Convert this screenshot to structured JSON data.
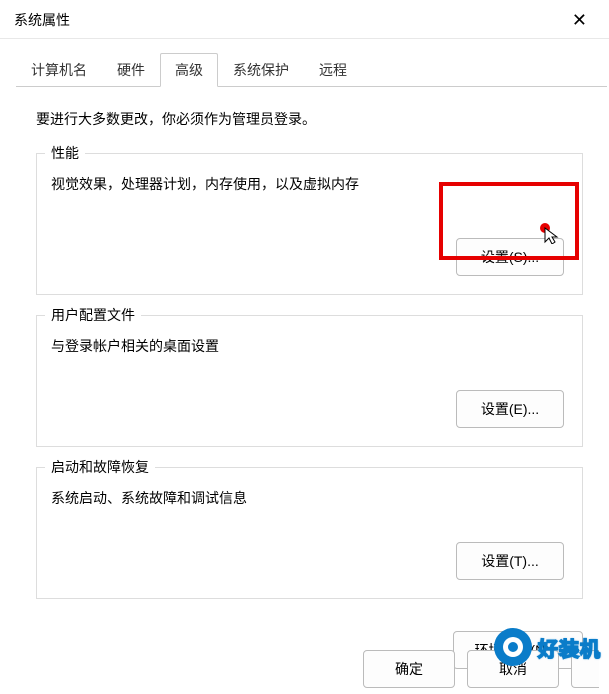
{
  "window": {
    "title": "系统属性",
    "close_icon": "✕"
  },
  "tabs": {
    "computer_name": "计算机名",
    "hardware": "硬件",
    "advanced": "高级",
    "system_protection": "系统保护",
    "remote": "远程"
  },
  "intro": "要进行大多数更改，你必须作为管理员登录。",
  "groups": {
    "performance": {
      "legend": "性能",
      "desc": "视觉效果，处理器计划，内存使用，以及虚拟内存",
      "button": "设置(S)..."
    },
    "user_profiles": {
      "legend": "用户配置文件",
      "desc": "与登录帐户相关的桌面设置",
      "button": "设置(E)..."
    },
    "startup_recovery": {
      "legend": "启动和故障恢复",
      "desc": "系统启动、系统故障和调试信息",
      "button": "设置(T)..."
    }
  },
  "env_button": "环境变量(N)...",
  "bottom": {
    "ok": "确定",
    "cancel": "取消"
  },
  "watermark": "好装机"
}
